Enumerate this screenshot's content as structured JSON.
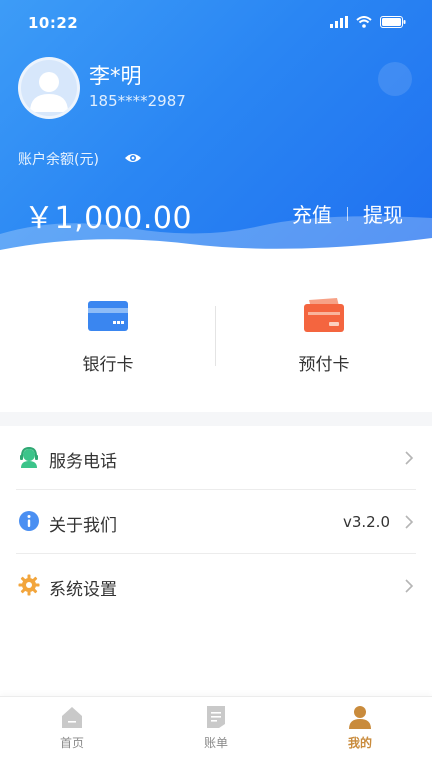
{
  "status_bar": {
    "time": "10:22"
  },
  "profile": {
    "name": "李*明",
    "phone": "185****2987"
  },
  "balance": {
    "label": "账户余额(元)",
    "amount": "￥1,000.00",
    "recharge_label": "充值",
    "withdraw_label": "提现"
  },
  "cards": [
    {
      "label": "银行卡",
      "icon": "bank-card-icon"
    },
    {
      "label": "预付卡",
      "icon": "prepaid-card-icon"
    }
  ],
  "menu": [
    {
      "label": "服务电话",
      "value": "",
      "icon": "headset-icon"
    },
    {
      "label": "关于我们",
      "value": "v3.2.0",
      "icon": "info-icon"
    },
    {
      "label": "系统设置",
      "value": "",
      "icon": "gear-icon"
    }
  ],
  "tabbar": {
    "active": "我的",
    "tabs": [
      {
        "label": "首页",
        "icon": "home-icon"
      },
      {
        "label": "账单",
        "icon": "bill-icon"
      },
      {
        "label": "我的",
        "icon": "user-icon"
      }
    ]
  },
  "colors": {
    "header_start": "#3d9cf7",
    "header_end": "#1f6ff0",
    "active_tab": "#c98b3c",
    "bank_card": "#3a86f0",
    "prepaid_card": "#f4653f"
  }
}
